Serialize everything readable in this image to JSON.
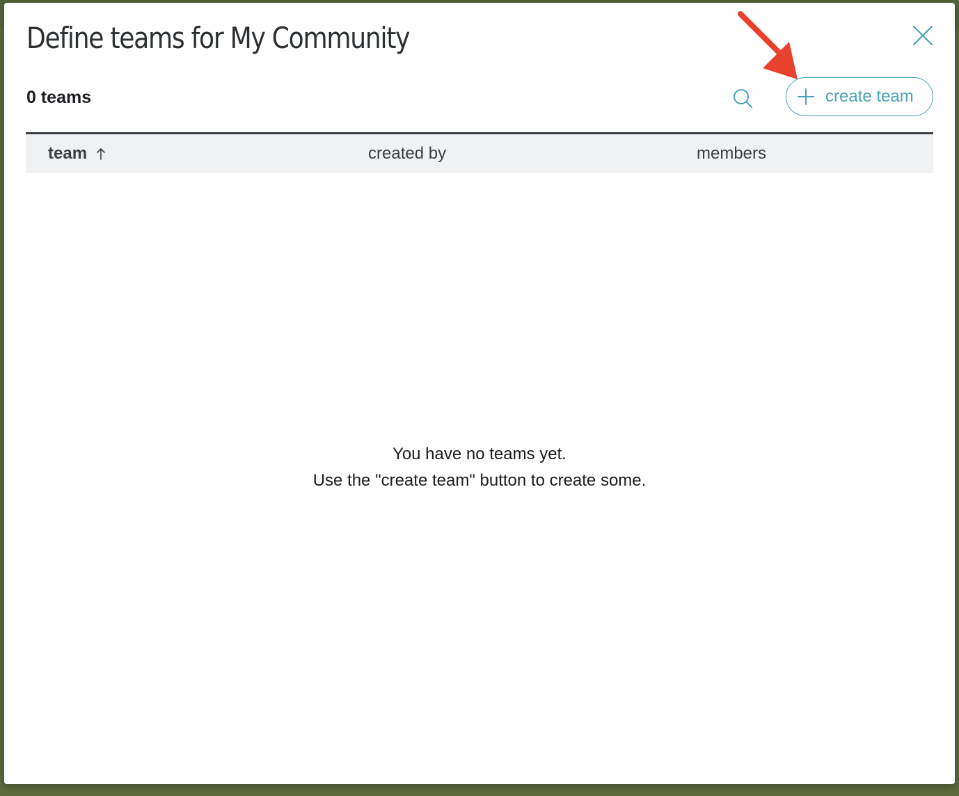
{
  "modal": {
    "title": "Define teams for My Community",
    "close_icon": "close-x-icon"
  },
  "toolbar": {
    "team_count": "0 teams",
    "search_icon": "search-icon",
    "create_button_label": "create team",
    "create_button_icon": "plus-icon"
  },
  "table": {
    "columns": [
      {
        "label": "team",
        "sort": "ascending"
      },
      {
        "label": "created by"
      },
      {
        "label": "members"
      }
    ],
    "rows": []
  },
  "empty_state": {
    "line1": "You have no teams yet.",
    "line2": "Use the \"create team\" button to create some."
  },
  "colors": {
    "accent": "#4aa3b4",
    "annotation_arrow": "#e8412c",
    "backdrop": "#5b6a3c"
  }
}
